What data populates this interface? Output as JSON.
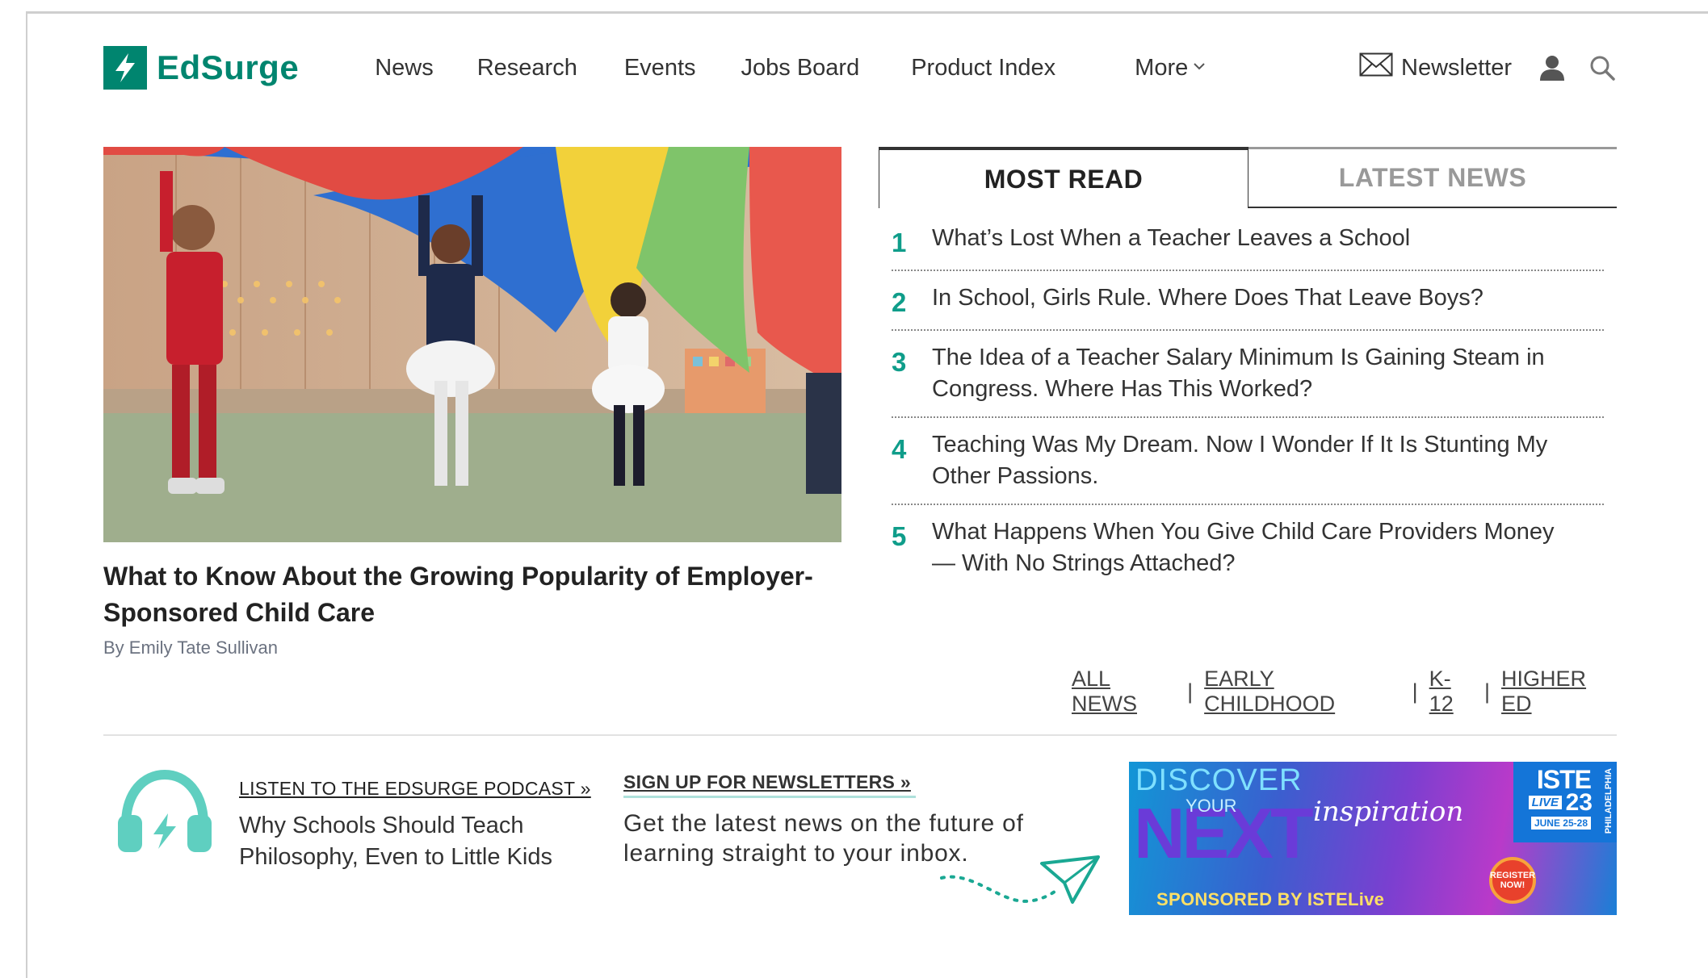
{
  "brand": {
    "name": "EdSurge",
    "color": "#00856f"
  },
  "nav": {
    "items": [
      {
        "label": "News"
      },
      {
        "label": "Research"
      },
      {
        "label": "Events"
      },
      {
        "label": "Jobs Board"
      },
      {
        "label": "Product Index"
      }
    ],
    "more_label": "More",
    "newsletter_label": "Newsletter",
    "icons": [
      "mail-icon",
      "user-icon",
      "search-icon",
      "chevron-down-icon"
    ]
  },
  "hero": {
    "title": "What to Know About the Growing Popularity of Employer-Sponsored Child Care",
    "byline": "By Emily Tate Sullivan"
  },
  "tabs": {
    "active": "MOST READ",
    "inactive": "LATEST NEWS"
  },
  "most_read": [
    {
      "num": "1",
      "title": "What’s Lost When a Teacher Leaves a School"
    },
    {
      "num": "2",
      "title": "In School, Girls Rule. Where Does That Leave Boys?"
    },
    {
      "num": "3",
      "title": "The Idea of a Teacher Salary Minimum Is Gaining Steam in Congress. Where Has This Worked?"
    },
    {
      "num": "4",
      "title": "Teaching Was My Dream. Now I Wonder If It Is Stunting My Other Passions."
    },
    {
      "num": "5",
      "title": "What Happens When You Give Child Care Providers Money — With No Strings Attached?"
    }
  ],
  "category_links": {
    "all": "ALL NEWS",
    "early": "EARLY CHILDHOOD",
    "k12": "K-12",
    "higher": "HIGHER ED",
    "sep": "|"
  },
  "podcast": {
    "link": "LISTEN TO THE EDSURGE PODCAST »",
    "title": "Why Schools Should Teach Philosophy, Even to Little Kids"
  },
  "signup": {
    "link": "SIGN UP FOR NEWSLETTERS »",
    "text": "Get the latest news on the future of learning straight to your inbox."
  },
  "ad": {
    "discover": "DISCOVER",
    "your": "YOUR",
    "next": "NEXT",
    "inspiration": "inspiration",
    "sponsored": "SPONSORED BY ISTELive",
    "iste": "ISTE",
    "live": "LIVE",
    "year": "23",
    "dates": "JUNE 25-28",
    "city": "PHILADELPHIA",
    "register": "REGISTER NOW!"
  },
  "colors": {
    "accent_teal": "#0f9d8a",
    "text_dark": "#333333",
    "byline_gray": "#6b7280"
  }
}
